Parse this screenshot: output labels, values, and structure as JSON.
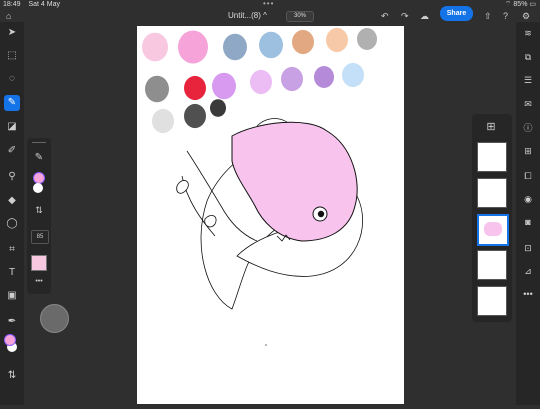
{
  "status": {
    "time": "18:49",
    "date": "Sat 4 May",
    "battery": "85%"
  },
  "toolbar": {
    "title": "Untit...(8) ^",
    "zoom": "30%",
    "share_label": "Share",
    "icons": [
      "undo-icon",
      "redo-icon",
      "cloud-icon",
      "export-icon",
      "help-icon",
      "settings-icon"
    ]
  },
  "left_tools": [
    "select-icon",
    "transform-icon",
    "lasso-icon",
    "brush-icon",
    "eraser-icon",
    "smudge-icon",
    "liquify-icon",
    "fill-icon",
    "shape-icon",
    "crop-icon",
    "text-icon",
    "place-image-icon",
    "eyedropper-icon",
    "color-icon",
    "swap-icon"
  ],
  "brush_panel": {
    "size": "85",
    "more": "•••"
  },
  "palette": [
    "#f8c8e0",
    "#f5a3d8",
    "#8fa8c6",
    "#9dc0e0",
    "#e2a882",
    "#f7c9a8",
    "#b0b0b0",
    "#8e8e8e",
    "#e8243c",
    "#d79af0",
    "#ebbdf4",
    "#c8a0e4",
    "#b58ad8",
    "#c4e0f8",
    "#505050",
    "#3a3a3a",
    "#e0e0e0"
  ],
  "layers_count": 5,
  "more_label": "•••",
  "accent": "#1473e6"
}
